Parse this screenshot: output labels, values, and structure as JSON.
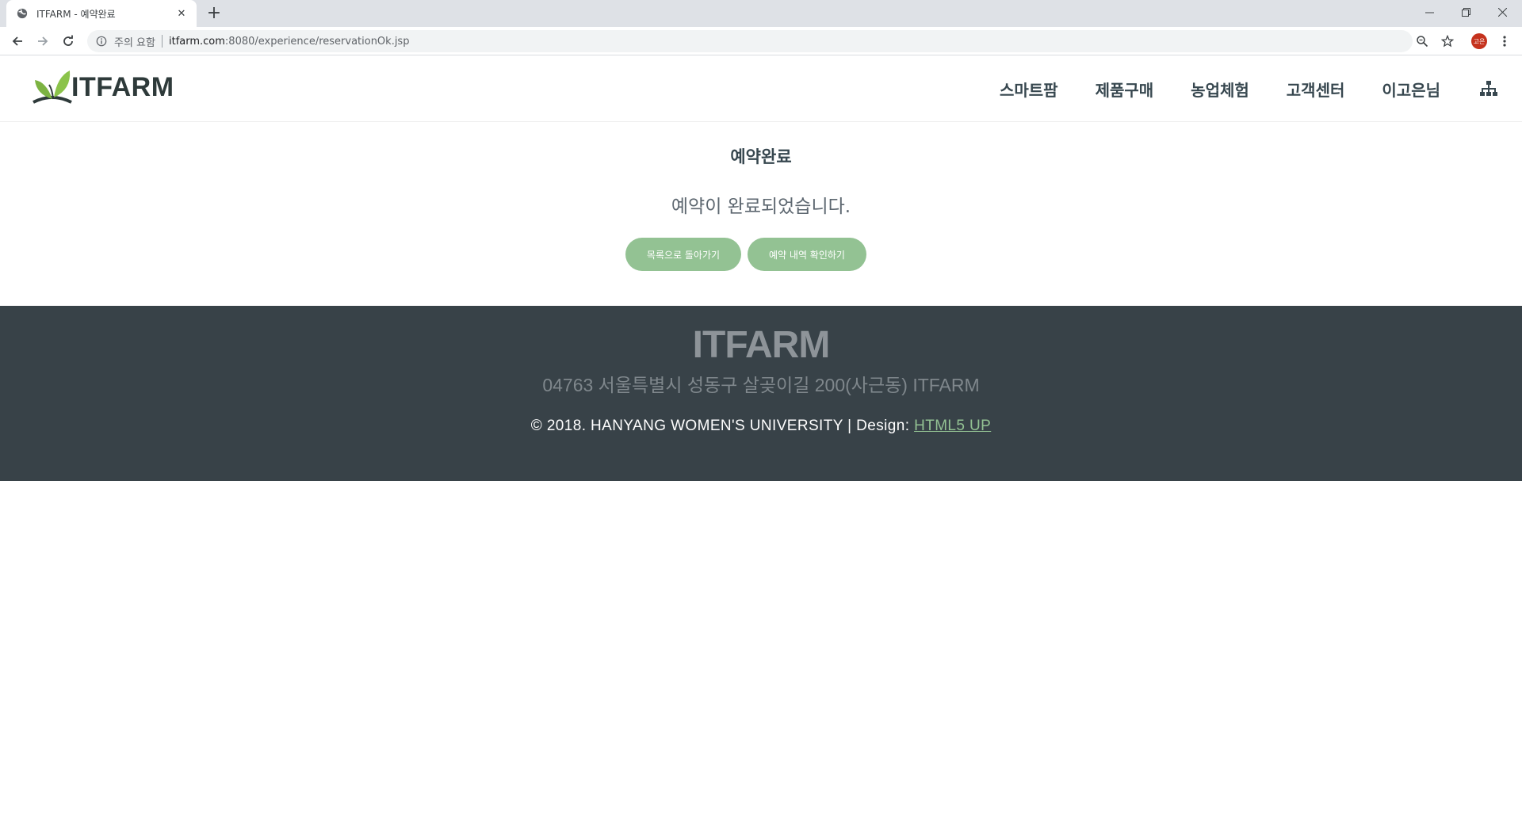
{
  "browser": {
    "tab_title": "ITFARM - 예약완료",
    "new_tab": "+",
    "security_warning": "주의 요함",
    "url_host": "itfarm.com",
    "url_path": ":8080/experience/reservationOk.jsp",
    "avatar_initials": "고은"
  },
  "header": {
    "logo_text": "ITFARM",
    "nav": [
      "스마트팜",
      "제품구매",
      "농업체험",
      "고객센터",
      "이고은님"
    ]
  },
  "main": {
    "title": "예약완료",
    "message": "예약이 완료되었습니다.",
    "btn_list": "목록으로 돌아가기",
    "btn_check": "예약 내역 확인하기"
  },
  "footer": {
    "logo": "ITFARM",
    "address": "04763 서울특별시 성동구 살곶이길 200(사근동) ITFARM",
    "copyright": "© 2018. HANYANG WOMEN'S UNIVERSITY | Design: ",
    "design_link": "HTML5 UP"
  },
  "colors": {
    "accent_green": "#93c293",
    "footer_bg": "#384248",
    "tabbar_bg": "#dee1e6"
  }
}
